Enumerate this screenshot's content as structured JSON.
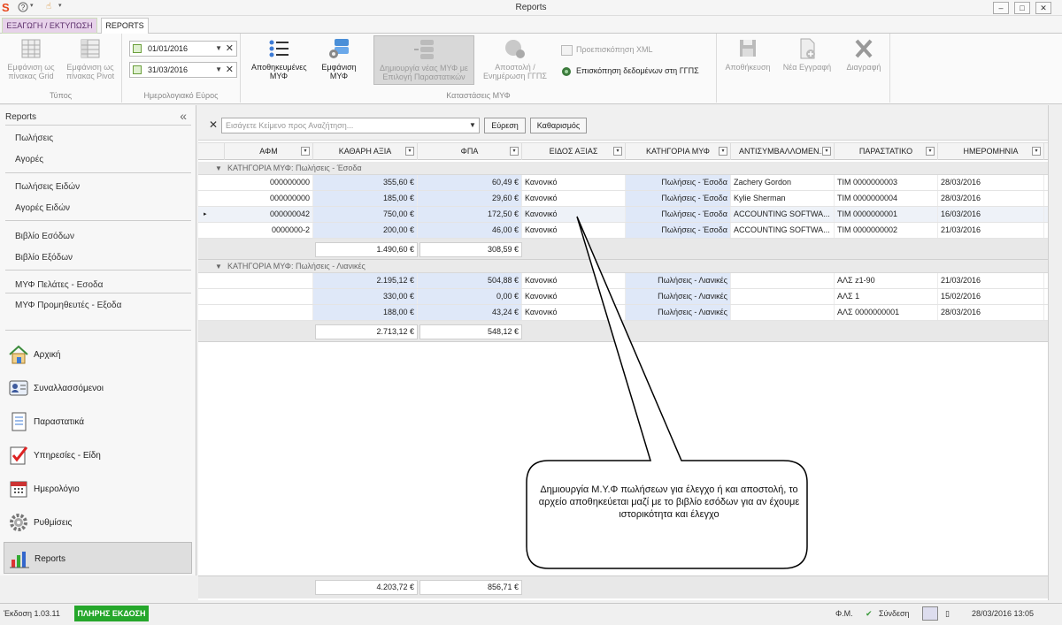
{
  "window": {
    "title": "Reports",
    "logo": "S",
    "qat_help": "?",
    "qat_hand": "☝"
  },
  "tabs": {
    "export": "ΕΞΑΓΩΓΗ / ΕΚΤΥΠΩΣΗ",
    "reports": "REPORTS"
  },
  "ribbon": {
    "type_group": {
      "label": "Τύπος",
      "grid_btn": "Εμφάνιση ως πίνακας Grid",
      "pivot_btn": "Εμφάνιση ως πίνακας Pivot"
    },
    "date_group": {
      "label": "Ημερολογιακό Εύρος",
      "from": "01/01/2016",
      "to": "31/03/2016"
    },
    "myf_group": {
      "label": "Καταστάσεις ΜΥΦ",
      "saved_btn": "Αποθηκευμένες ΜΥΦ",
      "show_btn": "Εμφάνιση ΜΥΦ",
      "create_btn": "Δημιουργία νέας ΜΥΦ με Επιλογή Παραστατικών",
      "send_btn": "Αποστολή / Ενημέρωση ΓΓΠΣ",
      "preview_xml": "Προεπισκόπηση XML",
      "review_ggps": "Επισκόπηση δεδομένων στη ΓΓΠΣ"
    },
    "save_group": {
      "save_btn": "Αποθήκευση",
      "new_btn": "Νέα Εγγραφή",
      "delete_btn": "Διαγραφή"
    }
  },
  "sidebar": {
    "header": "Reports",
    "items": [
      "Πωλήσεις",
      "Αγορές",
      "Πωλήσεις Ειδών",
      "Αγορές Ειδών",
      "Βιβλίο Εσόδων",
      "Βιβλίο Εξόδων",
      "ΜΥΦ Πελάτες - Εσοδα",
      "ΜΥΦ Προμηθευτές - Εξοδα"
    ],
    "nav": [
      "Αρχική",
      "Συναλλασσόμενοι",
      "Παραστατικά",
      "Υπηρεσίες - Είδη",
      "Ημερολόγιο",
      "Ρυθμίσεις",
      "Reports"
    ]
  },
  "search": {
    "placeholder": "Εισάγετε Κείμενο προς Αναζήτηση...",
    "find_btn": "Εύρεση",
    "clear_btn": "Καθαρισμός"
  },
  "grid": {
    "columns": [
      "ΑΦΜ",
      "ΚΑΘΑΡΗ ΑΞΙΑ",
      "ΦΠΑ",
      "ΕΙΔΟΣ ΑΞΙΑΣ",
      "ΚΑΤΗΓΟΡΙΑ ΜΥΦ",
      "ΑΝΤΙΣΥΜΒΑΛΛΟΜΕΝ...",
      "ΠΑΡΑΣΤΑΤΙΚΟ",
      "ΗΜΕΡΟΜΗΝΙΑ"
    ],
    "groups": [
      {
        "label": "ΚΑΤΗΓΟΡΙΑ ΜΥΦ: Πωλήσεις - Έσοδα",
        "rows": [
          {
            "afm": "000000000",
            "net": "355,60 €",
            "vat": "60,49 €",
            "kind": "Κανονικό",
            "cat": "Πωλήσεις - Έσοδα",
            "party": "Zachery Gordon",
            "doc": "ΤΙΜ 0000000003",
            "date": "28/03/2016"
          },
          {
            "afm": "000000000",
            "net": "185,00 €",
            "vat": "29,60 €",
            "kind": "Κανονικό",
            "cat": "Πωλήσεις - Έσοδα",
            "party": "Kylie Sherman",
            "doc": "ΤΙΜ 0000000004",
            "date": "28/03/2016"
          },
          {
            "afm": "000000042",
            "net": "750,00 €",
            "vat": "172,50 €",
            "kind": "Κανονικό",
            "cat": "Πωλήσεις - Έσοδα",
            "party": "ACCOUNTING SOFTWA...",
            "doc": "ΤΙΜ 0000000001",
            "date": "16/03/2016"
          },
          {
            "afm": "0000000-2",
            "net": "200,00 €",
            "vat": "46,00 €",
            "kind": "Κανονικό",
            "cat": "Πωλήσεις - Έσοδα",
            "party": "ACCOUNTING SOFTWA...",
            "doc": "ΤΙΜ 0000000002",
            "date": "21/03/2016"
          }
        ],
        "sum_net": "1.490,60 €",
        "sum_vat": "308,59 €"
      },
      {
        "label": "ΚΑΤΗΓΟΡΙΑ ΜΥΦ: Πωλήσεις - Λιανικές",
        "rows": [
          {
            "afm": "",
            "net": "2.195,12 €",
            "vat": "504,88 €",
            "kind": "Κανονικό",
            "cat": "Πωλήσεις - Λιανικές",
            "party": "",
            "doc": "ΑΛΣ z1-90",
            "date": "21/03/2016"
          },
          {
            "afm": "",
            "net": "330,00 €",
            "vat": "0,00 €",
            "kind": "Κανονικό",
            "cat": "Πωλήσεις - Λιανικές",
            "party": "",
            "doc": "ΑΛΣ 1",
            "date": "15/02/2016"
          },
          {
            "afm": "",
            "net": "188,00 €",
            "vat": "43,24 €",
            "kind": "Κανονικό",
            "cat": "Πωλήσεις - Λιανικές",
            "party": "",
            "doc": "ΑΛΣ 0000000001",
            "date": "28/03/2016"
          }
        ],
        "sum_net": "2.713,12 €",
        "sum_vat": "548,12 €"
      }
    ],
    "total_net": "4.203,72 €",
    "total_vat": "856,71 €"
  },
  "callout": "Δημιουργία Μ.Υ.Φ πωλήσεων για έλεγχο ή και αποστολή, το αρχείο αποθηκεύεται μαζί με  το βιβλίο εσόδων για αν έχουμε ιστορικότητα και έλεγχο",
  "status": {
    "version": "Έκδοση 1.03.11",
    "edition": "ΠΛΗΡΗΣ ΕΚΔΟΣΗ",
    "fm": "Φ.Μ.",
    "connect": "Σύνδεση",
    "datetime": "28/03/2016 13:05"
  }
}
